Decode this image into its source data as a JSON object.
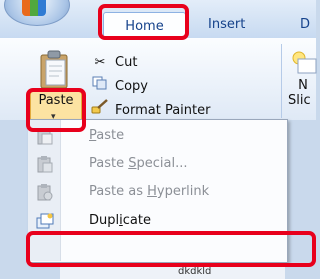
{
  "tabs": {
    "home": "Home",
    "insert": "Insert",
    "design": "D"
  },
  "clipboard": {
    "paste_label": "Paste",
    "paste_arrow": "▾",
    "cut": "Cut",
    "copy": "Copy",
    "format_painter": "Format Painter"
  },
  "new_slide": {
    "label_line1": "N",
    "label_line2": "Slic"
  },
  "paste_menu": [
    {
      "label_pre": "",
      "mnemonic": "P",
      "label_post": "aste",
      "enabled": false
    },
    {
      "label_pre": "Paste ",
      "mnemonic": "S",
      "label_post": "pecial...",
      "enabled": false
    },
    {
      "label_pre": "Paste as ",
      "mnemonic": "H",
      "label_post": "yperlink",
      "enabled": false
    },
    {
      "label_pre": "Dupl",
      "mnemonic": "i",
      "label_post": "cate",
      "enabled": true
    }
  ],
  "bottom_text": "dkdkld",
  "colors": {
    "highlight": "#e8001c",
    "ribbon_text": "#15428b",
    "paste_active": "#fce3a2"
  }
}
